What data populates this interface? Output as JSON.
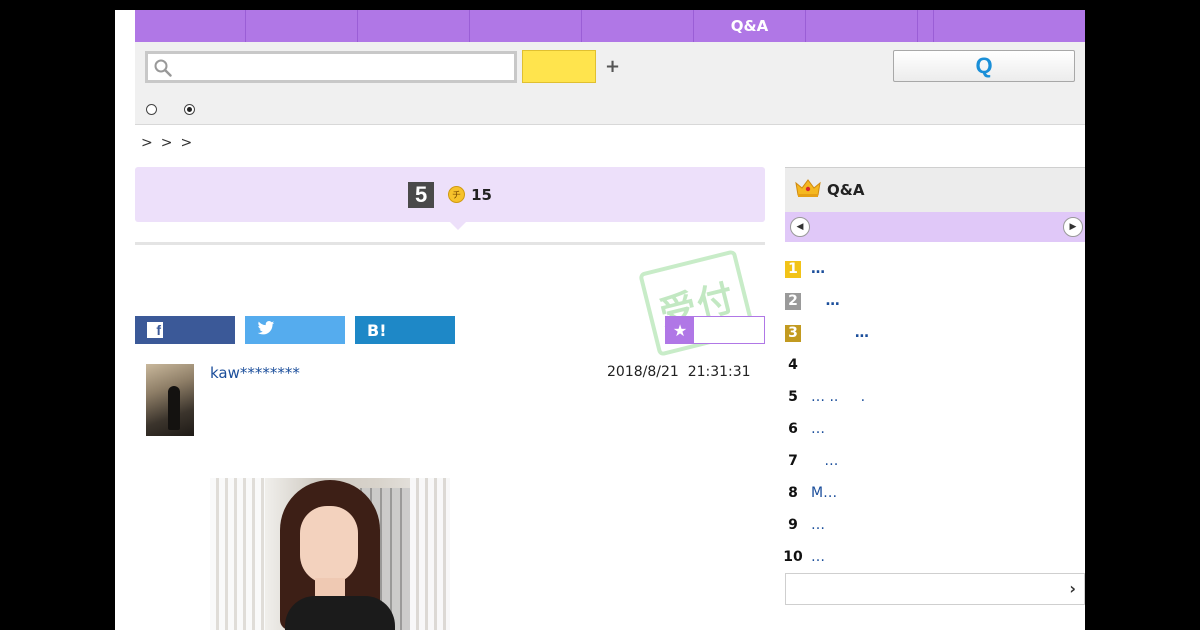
{
  "nav": {
    "tabs": [
      "",
      "",
      "",
      "",
      "",
      "Q&A",
      "",
      "",
      ""
    ]
  },
  "search": {
    "placeholder": "",
    "options": {
      "first": "",
      "second": "",
      "selected": "second"
    },
    "plus_label": "+",
    "ask_label": "Q"
  },
  "breadcrumb": [
    ">",
    ">",
    ">"
  ],
  "question": {
    "answer_count": "5",
    "coin_symbol": "チ",
    "coin_count": "15",
    "stamp_text": "受付"
  },
  "share": {
    "facebook_icon": "f",
    "twitter_icon": "twitter-bird",
    "hatena_label": "B!",
    "favorite_icon": "★"
  },
  "post": {
    "username": "kaw********",
    "date": "2018/8/21",
    "time": "21:31:31"
  },
  "ranking": {
    "title": "Q&A",
    "items": [
      {
        "rank": "1",
        "text": "…",
        "style": "gold"
      },
      {
        "rank": "2",
        "text": "   …",
        "style": "silver"
      },
      {
        "rank": "3",
        "text": "         …",
        "style": "bronze"
      },
      {
        "rank": "4",
        "text": "",
        "style": "plain"
      },
      {
        "rank": "5",
        "text": "… ..     .",
        "style": "plain"
      },
      {
        "rank": "6",
        "text": "…",
        "style": "plain"
      },
      {
        "rank": "7",
        "text": "   …",
        "style": "plain"
      },
      {
        "rank": "8",
        "text": "M…",
        "style": "plain"
      },
      {
        "rank": "9",
        "text": "…",
        "style": "plain"
      },
      {
        "rank": "10",
        "text": "…",
        "style": "plain"
      }
    ],
    "more_icon": "›"
  },
  "colors": {
    "accent_purple": "#b077e6",
    "header_lavender": "#ede0fa",
    "search_yellow": "#ffe44d",
    "link_blue": "#1b4e9b",
    "facebook": "#3b5998",
    "twitter": "#55acee",
    "hatena": "#1e88c7"
  }
}
